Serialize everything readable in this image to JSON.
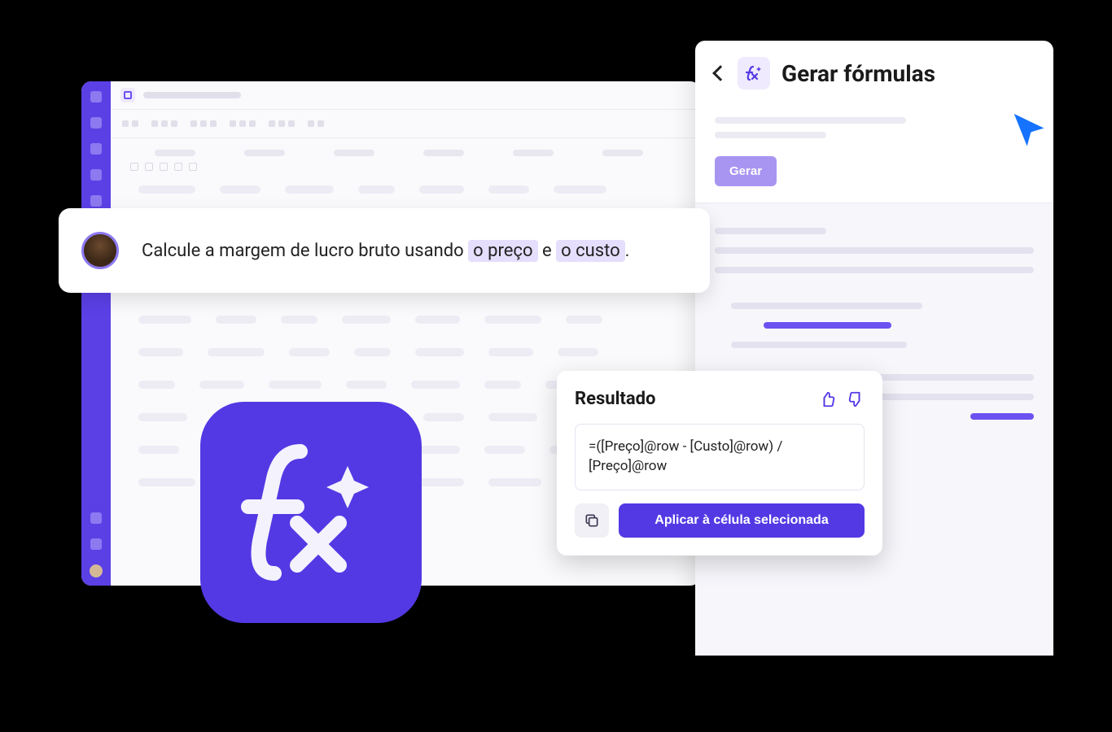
{
  "panel": {
    "title": "Gerar fórmulas",
    "generate_button": "Gerar"
  },
  "prompt": {
    "text_before": "Calcule a margem de lucro bruto usando ",
    "highlight1": "o preço",
    "text_mid": " e ",
    "highlight2": "o custo",
    "text_after": "."
  },
  "result": {
    "title": "Resultado",
    "formula": "=([Preço]@row - [Custo]@row) / [Preço]@row",
    "apply_button": "Aplicar à célula selecionada"
  },
  "colors": {
    "brand": "#5339e4",
    "brand_light": "#a895f2",
    "highlight_bg": "#e5defc",
    "cursor": "#1573ff"
  }
}
